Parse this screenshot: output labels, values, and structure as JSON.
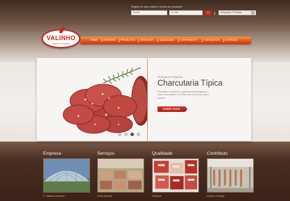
{
  "utility": {
    "notice": "Registe-se como cliente e receba as novidades",
    "name_placeholder": "Nome",
    "email_placeholder": "E-mail",
    "ok_label": "ok",
    "search_placeholder": "Pesquisar Produtos"
  },
  "logo": {
    "name": "VALINHO",
    "tagline": "alegria com tradição"
  },
  "nav": {
    "items": [
      {
        "label": "HOME"
      },
      {
        "label": "EMPRESA"
      },
      {
        "label": "PRODUTOS"
      },
      {
        "label": "SERVIÇOS"
      },
      {
        "label": "QUALIDADE"
      },
      {
        "label": "CONTRIBUTO"
      },
      {
        "label": "CONTACTOS"
      },
      {
        "label": "NOTÍCIAS"
      }
    ]
  },
  "hero": {
    "subtitle": "Produtos Fatiados",
    "title": "Charcutaria Típica",
    "description": "Presentes na cozinha e gastronomia alentejana, o nosso charcutaria e enchidos são um prazer para o paladar.",
    "button_label": "SABER MAIS",
    "slide_count": 4,
    "active_slide": 3
  },
  "sections": [
    {
      "title": "Empresa",
      "caption": "C. Valinho aumento"
    },
    {
      "title": "Serviços",
      "caption": "Linha Horeca"
    },
    {
      "title": "Qualidade",
      "caption": "Fatiados"
    },
    {
      "title": "Contributo",
      "caption": "Carnes Frescas"
    }
  ],
  "colors": {
    "brand_red": "#c8261f",
    "nav_orange": "#e3591f",
    "caption_gold": "#f1b84a",
    "background_brown": "#3a2219"
  }
}
